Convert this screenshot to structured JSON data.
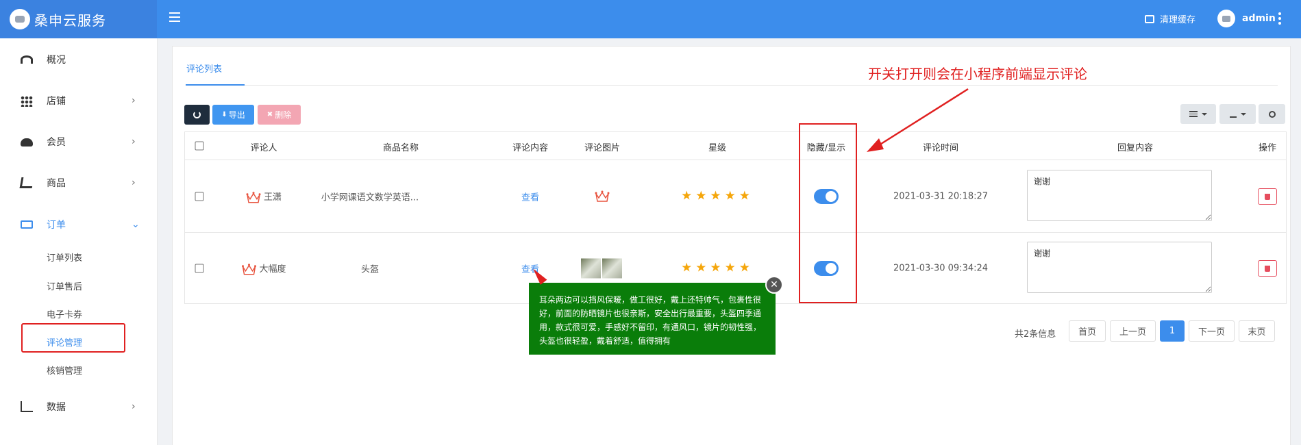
{
  "header": {
    "brand_title": "桑申云服务",
    "clear_cache_label": "清理缓存",
    "username": "admin",
    "color": "#3c8dec"
  },
  "sidebar": {
    "items": [
      {
        "label": "概况",
        "icon": "dashboard-icon"
      },
      {
        "label": "店铺",
        "icon": "grid-icon",
        "arrow": "›"
      },
      {
        "label": "会员",
        "icon": "users-icon",
        "arrow": "›"
      },
      {
        "label": "商品",
        "icon": "cart-icon",
        "arrow": "›"
      },
      {
        "label": "订单",
        "icon": "money-icon",
        "arrow": "⌄"
      },
      {
        "label": "数据",
        "icon": "chart-icon",
        "arrow": "›"
      }
    ],
    "order_submenu": [
      "订单列表",
      "订单售后",
      "电子卡券",
      "评论管理",
      "核销管理"
    ]
  },
  "tab": {
    "label": "评论列表"
  },
  "toolbar": {
    "export_label": "导出",
    "delete_label": "删除"
  },
  "table": {
    "headers": [
      "评论人",
      "商品名称",
      "评论内容",
      "评论图片",
      "星级",
      "隐藏/显示",
      "评论时间",
      "回复内容",
      "操作"
    ],
    "rows": [
      {
        "reviewer": "王潇",
        "product": "小学网课语文数学英语...",
        "content_link": "查看",
        "stars": "★★★★★",
        "visible": true,
        "time": "2021-03-31 20:18:27",
        "reply": "谢谢"
      },
      {
        "reviewer": "大幅度",
        "product": "头盔",
        "content_link": "查看",
        "stars": "★★★★★",
        "visible": true,
        "time": "2021-03-30 09:34:24",
        "reply": "谢谢"
      }
    ]
  },
  "pagination": {
    "info": "共2条信息",
    "first": "首页",
    "prev": "上一页",
    "current": "1",
    "next": "下一页",
    "last": "末页"
  },
  "popup": {
    "text": "耳朵两边可以挡风保暖，做工很好，戴上还特帅气，包裹性很好，前面的防晒镜片也很亲斯，安全出行最重要，头盔四季通用，款式很可爱，手感好不留印，有通风口，镜片的韧性强，头盔也很轻盈，戴着舒适，值得拥有",
    "close": "✕"
  },
  "annotation": {
    "text": "开关打开则会在小程序前端显示评论",
    "color": "#e02020"
  }
}
